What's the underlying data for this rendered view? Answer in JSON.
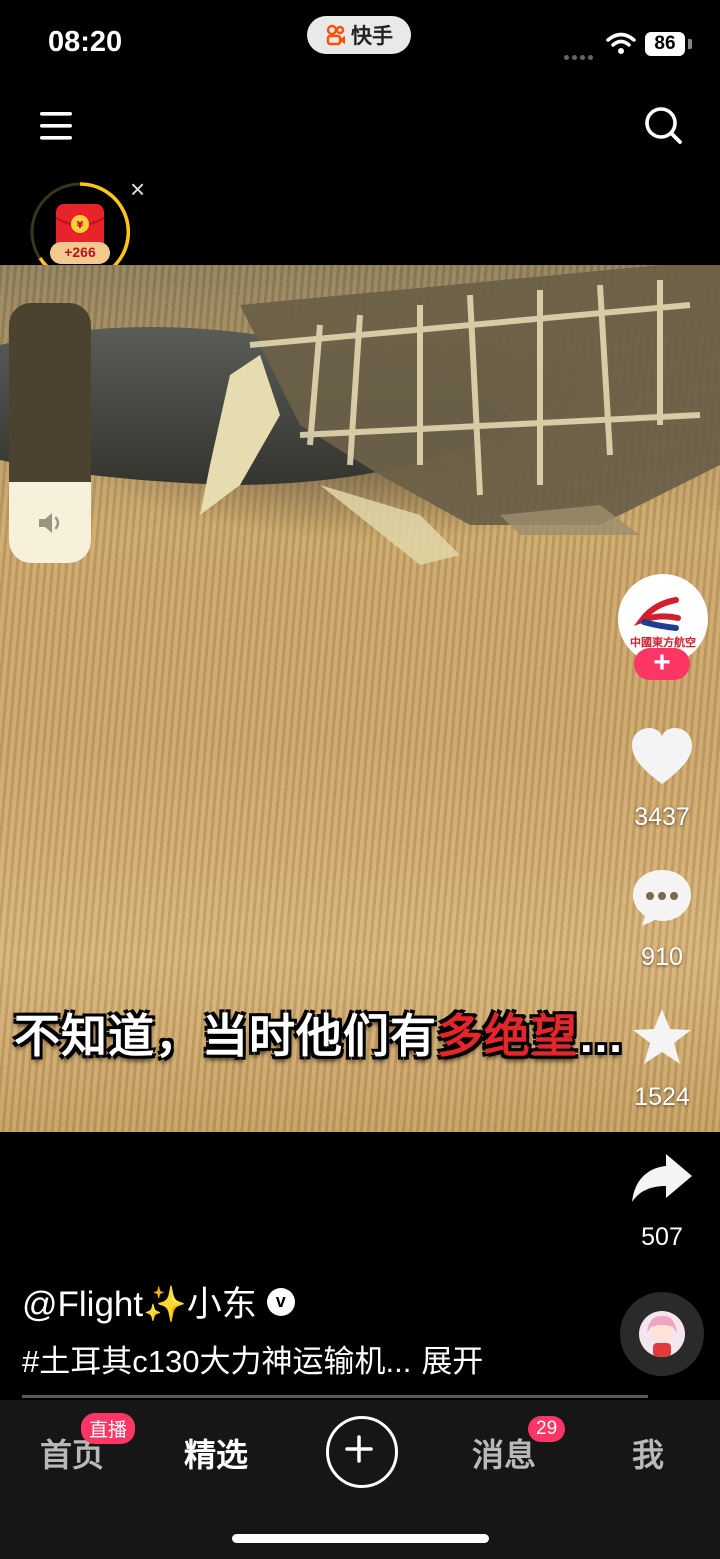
{
  "status_bar": {
    "time": "08:20",
    "app_name": "快手",
    "battery": "86"
  },
  "reward": {
    "amount": "+266",
    "close": "×"
  },
  "video": {
    "subtitle_white": "不知道，当时他们有",
    "subtitle_red": "多绝望",
    "subtitle_end": "…"
  },
  "volume": {
    "level": 0.31
  },
  "creator": {
    "avatar_text": "中國東方航空",
    "follow_label": "+"
  },
  "actions": {
    "likes": "3437",
    "comments": "910",
    "favorites": "1524",
    "shares": "507"
  },
  "caption": {
    "author": "@Flight✨小东",
    "verified": "v",
    "description": "#土耳其c130大力神运输机...",
    "expand": "展开"
  },
  "nav": {
    "home": "首页",
    "home_badge": "直播",
    "featured": "精选",
    "messages": "消息",
    "messages_badge": "29",
    "me": "我"
  },
  "colors": {
    "accent": "#fe3666",
    "background": "#000000",
    "nav_background": "#161616"
  }
}
